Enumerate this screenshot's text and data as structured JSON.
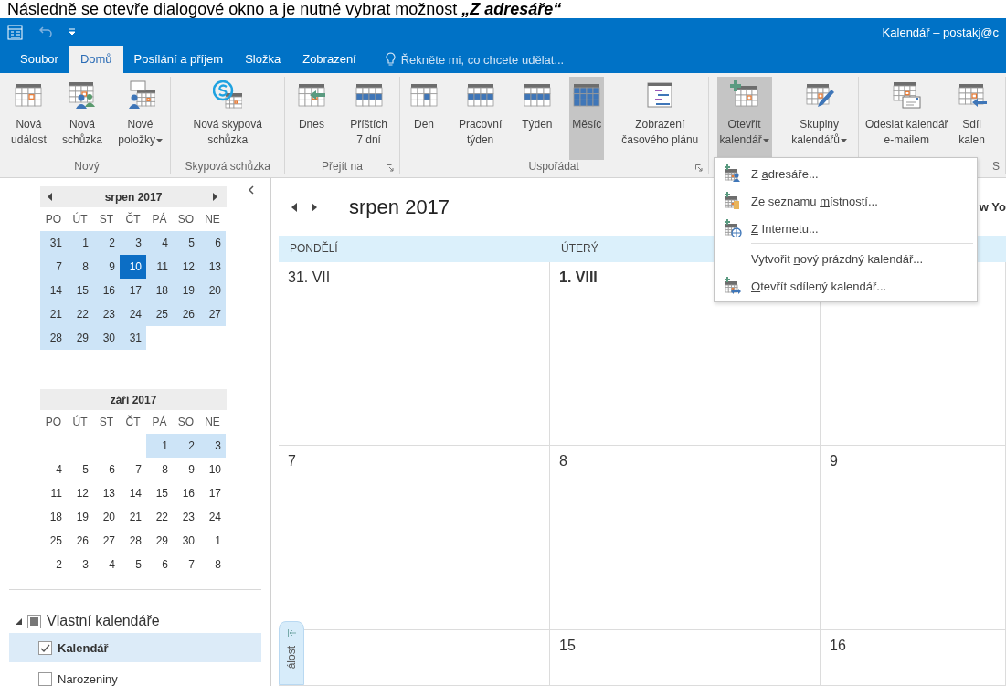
{
  "caption": {
    "text": "Následně se otevře dialogové okno a je nutné vybrat možnost **„Z adresáře“**"
  },
  "title_bar": {
    "title": "Kalendář – postakj@c"
  },
  "tabs": [
    {
      "label": "Soubor",
      "selected": false
    },
    {
      "label": "Domů",
      "selected": true
    },
    {
      "label": "Posílání a příjem",
      "selected": false
    },
    {
      "label": "Složka",
      "selected": false
    },
    {
      "label": "Zobrazení",
      "selected": false
    }
  ],
  "tell_me": {
    "placeholder": "Řekněte mi, co chcete udělat..."
  },
  "ribbon": {
    "groups": [
      {
        "label": "Nový",
        "launcher": false,
        "buttons": [
          {
            "lines": [
              "Nová",
              "událost"
            ],
            "dropdown": false,
            "selected": false
          },
          {
            "lines": [
              "Nová",
              "schůzka"
            ],
            "dropdown": false,
            "selected": false
          },
          {
            "lines": [
              "Nové",
              "položky"
            ],
            "dropdown": true,
            "selected": false
          }
        ]
      },
      {
        "label": "Skypová schůzka",
        "launcher": false,
        "buttons": [
          {
            "lines": [
              "Nová skypová",
              "schůzka"
            ],
            "dropdown": false,
            "selected": false
          }
        ]
      },
      {
        "label": "Přejít na",
        "launcher": true,
        "buttons": [
          {
            "lines": [
              "Dnes"
            ],
            "dropdown": false,
            "selected": false
          },
          {
            "lines": [
              "Příštích",
              "7 dní"
            ],
            "dropdown": false,
            "selected": false
          }
        ]
      },
      {
        "label": "Uspořádat",
        "launcher": true,
        "buttons": [
          {
            "lines": [
              "Den"
            ],
            "dropdown": false,
            "selected": false
          },
          {
            "lines": [
              "Pracovní",
              "týden"
            ],
            "dropdown": false,
            "selected": false
          },
          {
            "lines": [
              "Týden"
            ],
            "dropdown": false,
            "selected": false
          },
          {
            "lines": [
              "Měsíc"
            ],
            "dropdown": false,
            "selected": true
          },
          {
            "lines": [
              "Zobrazení",
              "časového plánu"
            ],
            "dropdown": false,
            "selected": false
          }
        ]
      },
      {
        "launcher": false,
        "buttons": [
          {
            "lines": [
              "Otevřít",
              "kalendář"
            ],
            "dropdown": true,
            "selected": true
          },
          {
            "lines": [
              "Skupiny",
              "kalendářů"
            ],
            "dropdown": true,
            "selected": false
          }
        ]
      },
      {
        "label": "S",
        "launcher": false,
        "buttons": [
          {
            "lines": [
              "Odeslat kalendář",
              "e-mailem"
            ],
            "dropdown": false,
            "selected": false
          },
          {
            "lines": [
              "Sdíl",
              "kalen"
            ],
            "dropdown": false,
            "selected": false
          }
        ]
      }
    ]
  },
  "mini_calendars": [
    {
      "title": "srpen 2017",
      "nav": true,
      "weekdays": [
        "PO",
        "ÚT",
        "ST",
        "ČT",
        "PÁ",
        "SO",
        "NE"
      ],
      "weeks": [
        [
          {
            "day": "31",
            "in_view": true,
            "today": false
          },
          {
            "day": "1",
            "in_view": true,
            "today": false
          },
          {
            "day": "2",
            "in_view": true,
            "today": false
          },
          {
            "day": "3",
            "in_view": true,
            "today": false
          },
          {
            "day": "4",
            "in_view": true,
            "today": false
          },
          {
            "day": "5",
            "in_view": true,
            "today": false
          },
          {
            "day": "6",
            "in_view": true,
            "today": false
          }
        ],
        [
          {
            "day": "7",
            "in_view": true,
            "today": false
          },
          {
            "day": "8",
            "in_view": true,
            "today": false
          },
          {
            "day": "9",
            "in_view": true,
            "today": false
          },
          {
            "day": "10",
            "in_view": true,
            "today": true
          },
          {
            "day": "11",
            "in_view": true,
            "today": false
          },
          {
            "day": "12",
            "in_view": true,
            "today": false
          },
          {
            "day": "13",
            "in_view": true,
            "today": false
          }
        ],
        [
          {
            "day": "14",
            "in_view": true,
            "today": false
          },
          {
            "day": "15",
            "in_view": true,
            "today": false
          },
          {
            "day": "16",
            "in_view": true,
            "today": false
          },
          {
            "day": "17",
            "in_view": true,
            "today": false
          },
          {
            "day": "18",
            "in_view": true,
            "today": false
          },
          {
            "day": "19",
            "in_view": true,
            "today": false
          },
          {
            "day": "20",
            "in_view": true,
            "today": false
          }
        ],
        [
          {
            "day": "21",
            "in_view": true,
            "today": false
          },
          {
            "day": "22",
            "in_view": true,
            "today": false
          },
          {
            "day": "23",
            "in_view": true,
            "today": false
          },
          {
            "day": "24",
            "in_view": true,
            "today": false
          },
          {
            "day": "25",
            "in_view": true,
            "today": false
          },
          {
            "day": "26",
            "in_view": true,
            "today": false
          },
          {
            "day": "27",
            "in_view": true,
            "today": false
          }
        ],
        [
          {
            "day": "28",
            "in_view": true,
            "today": false
          },
          {
            "day": "29",
            "in_view": true,
            "today": false
          },
          {
            "day": "30",
            "in_view": true,
            "today": false
          },
          {
            "day": "31",
            "in_view": true,
            "today": false
          }
        ]
      ]
    },
    {
      "title": "září 2017",
      "nav": false,
      "weekdays": [
        "PO",
        "ÚT",
        "ST",
        "ČT",
        "PÁ",
        "SO",
        "NE"
      ],
      "weeks": [
        [
          {
            "in_view": false,
            "today": false
          },
          {
            "in_view": false,
            "today": false
          },
          {
            "in_view": false,
            "today": false
          },
          {
            "in_view": false,
            "today": false
          },
          {
            "day": "1",
            "in_view": true,
            "today": false
          },
          {
            "day": "2",
            "in_view": true,
            "today": false
          },
          {
            "day": "3",
            "in_view": true,
            "today": false
          }
        ],
        [
          {
            "day": "4",
            "in_view": false,
            "today": false
          },
          {
            "day": "5",
            "in_view": false,
            "today": false
          },
          {
            "day": "6",
            "in_view": false,
            "today": false
          },
          {
            "day": "7",
            "in_view": false,
            "today": false
          },
          {
            "day": "8",
            "in_view": false,
            "today": false
          },
          {
            "day": "9",
            "in_view": false,
            "today": false
          },
          {
            "day": "10",
            "in_view": false,
            "today": false
          }
        ],
        [
          {
            "day": "11",
            "in_view": false,
            "today": false
          },
          {
            "day": "12",
            "in_view": false,
            "today": false
          },
          {
            "day": "13",
            "in_view": false,
            "today": false
          },
          {
            "day": "14",
            "in_view": false,
            "today": false
          },
          {
            "day": "15",
            "in_view": false,
            "today": false
          },
          {
            "day": "16",
            "in_view": false,
            "today": false
          },
          {
            "day": "17",
            "in_view": false,
            "today": false
          }
        ],
        [
          {
            "day": "18",
            "in_view": false,
            "today": false
          },
          {
            "day": "19",
            "in_view": false,
            "today": false
          },
          {
            "day": "20",
            "in_view": false,
            "today": false
          },
          {
            "day": "21",
            "in_view": false,
            "today": false
          },
          {
            "day": "22",
            "in_view": false,
            "today": false
          },
          {
            "day": "23",
            "in_view": false,
            "today": false
          },
          {
            "day": "24",
            "in_view": false,
            "today": false
          }
        ],
        [
          {
            "day": "25",
            "in_view": false,
            "today": false
          },
          {
            "day": "26",
            "in_view": false,
            "today": false
          },
          {
            "day": "27",
            "in_view": false,
            "today": false
          },
          {
            "day": "28",
            "in_view": false,
            "today": false
          },
          {
            "day": "29",
            "in_view": false,
            "today": false
          },
          {
            "day": "30",
            "in_view": false,
            "today": false
          },
          {
            "day": "1",
            "in_view": false,
            "today": false
          }
        ],
        [
          {
            "day": "2",
            "in_view": false,
            "today": false
          },
          {
            "day": "3",
            "in_view": false,
            "today": false
          },
          {
            "day": "4",
            "in_view": false,
            "today": false
          },
          {
            "day": "5",
            "in_view": false,
            "today": false
          },
          {
            "day": "6",
            "in_view": false,
            "today": false
          },
          {
            "day": "7",
            "in_view": false,
            "today": false
          },
          {
            "day": "8",
            "in_view": false,
            "today": false
          }
        ]
      ]
    }
  ],
  "folders": {
    "label": "Vlastní kalendáře",
    "expanded": true,
    "mixed": true,
    "children": [
      {
        "label": "Kalendář",
        "checked": true,
        "selected": true
      },
      {
        "label": "Narozeniny",
        "checked": false,
        "selected": false
      }
    ]
  },
  "main": {
    "title": "srpen 2017",
    "weather": "w Yo",
    "columns": [
      "PONDĚLÍ",
      "ÚTERÝ"
    ],
    "weeks": [
      [
        {
          "kind": "date",
          "date": "31. VII",
          "first_of_month": false
        },
        {
          "kind": "date",
          "date": "1. VIII",
          "first_of_month": true
        },
        {
          "kind": "empty"
        }
      ],
      [
        {
          "kind": "date",
          "date": "7",
          "first_of_month": false
        },
        {
          "kind": "date",
          "date": "8",
          "first_of_month": false
        },
        {
          "kind": "date",
          "date": "9",
          "first_of_month": false
        }
      ],
      [
        {
          "kind": "empty"
        },
        {
          "kind": "date",
          "date": "15",
          "first_of_month": false
        },
        {
          "kind": "date",
          "date": "16",
          "first_of_month": false
        }
      ]
    ],
    "peek": {
      "label": "álost"
    }
  },
  "dropdown": {
    "items": [
      {
        "kind": "command",
        "before": "Z ",
        "key": "a",
        "after": "dresáře..."
      },
      {
        "kind": "command",
        "before": "Ze seznamu ",
        "key": "m",
        "after": "ístností..."
      },
      {
        "kind": "command",
        "key": "Z",
        "after": " Internetu..."
      },
      {
        "kind": "separator"
      },
      {
        "kind": "command",
        "before": "Vytvořit ",
        "key": "n",
        "after": "ový prázdný kalendář..."
      },
      {
        "kind": "command",
        "key": "O",
        "after": "tevřít sdílený kalendář..."
      }
    ]
  }
}
